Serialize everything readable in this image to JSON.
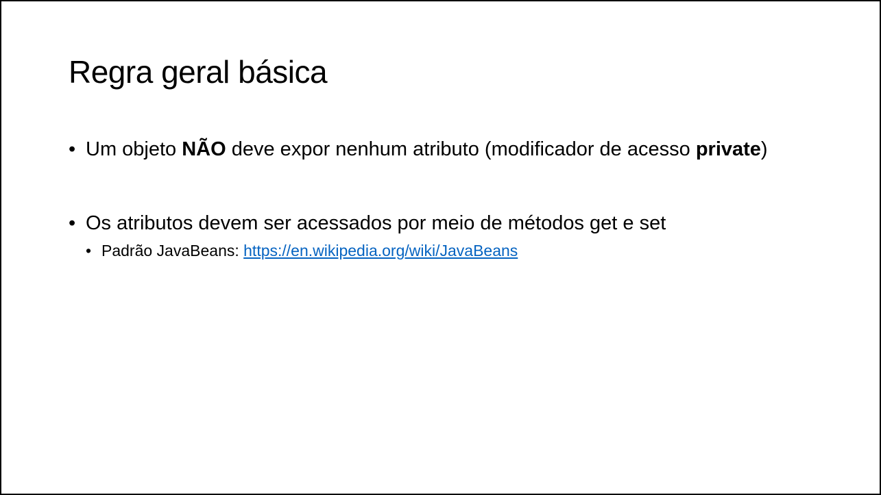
{
  "slide": {
    "title": "Regra geral básica",
    "bullets": [
      {
        "part1": "Um objeto ",
        "bold1": "NÃO",
        "part2": " deve expor nenhum atributo (modificador de acesso ",
        "bold2": "private",
        "part3": ")"
      },
      {
        "text": "Os atributos devem ser acessados por meio de métodos get e set",
        "sub": {
          "label": "Padrão JavaBeans: ",
          "link_text": "https://en.wikipedia.org/wiki/JavaBeans",
          "link_href": "https://en.wikipedia.org/wiki/JavaBeans"
        }
      }
    ],
    "bullet_char": "•",
    "link_color": "#0563c1"
  }
}
